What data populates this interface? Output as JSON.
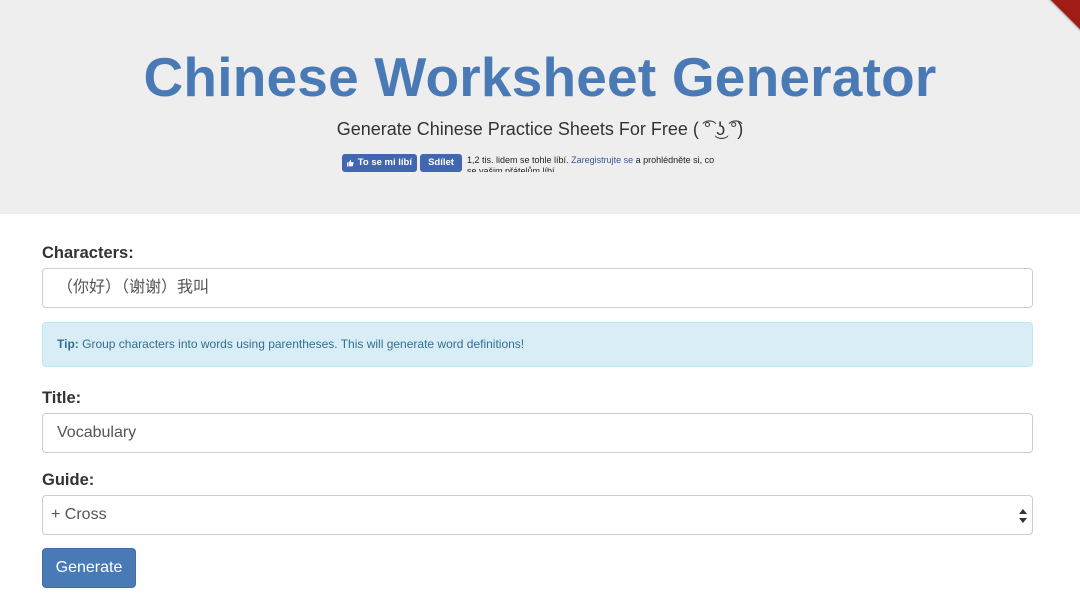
{
  "header": {
    "title": "Chinese Worksheet Generator",
    "subtitle": "Generate Chinese Practice Sheets For Free ( ͡° ͜ʖ ͡°)",
    "facebook": {
      "like_label": "To se mi líbí",
      "share_label": "Sdílet",
      "count_text": "1,2 tis. lidem se tohle líbí.",
      "signup_link": "Zaregistrujte se",
      "rest_text": "a prohlédněte si, co se vašim přátelům líbí."
    }
  },
  "form": {
    "characters_label": "Characters:",
    "characters_value": "（你好）（谢谢）我叫",
    "tip_bold": "Tip:",
    "tip_text": "Group characters into words using parentheses. This will generate word definitions!",
    "title_label": "Title:",
    "title_value": "Vocabulary",
    "guide_label": "Guide:",
    "guide_selected": "+ Cross",
    "generate_label": "Generate"
  },
  "colors": {
    "brand": "#4a7ab5",
    "hero_bg": "#eeeeee",
    "tip_bg": "#d9edf7",
    "facebook": "#4267b2"
  }
}
